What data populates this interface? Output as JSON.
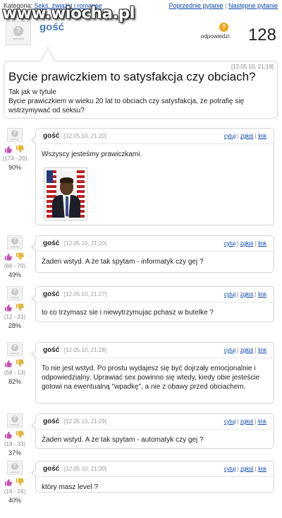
{
  "watermark": "www.wiocha.pl",
  "category": {
    "label": "Kategoria:",
    "value": "Seks, związki i romanse"
  },
  "nav": {
    "prev": "Poprzednie pytanie",
    "sep": "|",
    "next": "Następne pytanie"
  },
  "op": {
    "name": "gość",
    "avatar_text": "samotuto"
  },
  "answers": {
    "label": "odpowiedzi:",
    "count": "128"
  },
  "question": {
    "date": "[12.05.10, 21:19]",
    "title": "Bycie prawiczkiem to satysfakcja czy obciach?",
    "body": "Tak jak w tytule\nBycie prawiczkiem w wieku 20 lat to obciach czy satysfakcja, że potrafię się wstrzymywać od seksu?"
  },
  "link_labels": {
    "quote": "cytuj",
    "report": "zgłoś",
    "link": "link",
    "sep": "|"
  },
  "comments": [
    {
      "author": "gość",
      "date": "[12.05.10, 21:20]",
      "text": "Wszyscy jesteśmy prawiczkami.",
      "votes": "(174 - 20)",
      "percent": "90%",
      "has_image": true
    },
    {
      "author": "gość",
      "date": "[12.05.10, 21:20]",
      "text": "Żaden wstyd. A że tak spytam - informatyk czy gej ?",
      "votes": "(66 - 70)",
      "percent": "49%",
      "has_image": false
    },
    {
      "author": "gość",
      "date": "[12.05.10, 21:27]",
      "text": "to co trzymasz sie i niewytrzymujac pchasz w butelke ?",
      "votes": "(12 - 31)",
      "percent": "28%",
      "has_image": false
    },
    {
      "author": "gość",
      "date": "[12.05.10, 21:28]",
      "text": "To nie jest wstyd. Po prostu wydajesz się być dojrzały emocjonalnie i odpowiedzialny. Uprawiać sex powinno się wtedy, kiedy obie jesteście gotowi na ewentualną \"wpadkę\", a nie z obawy przed obciachem.",
      "votes": "(58 - 13)",
      "percent": "82%",
      "has_image": false
    },
    {
      "author": "gość",
      "date": "[12.05.10, 21:29]",
      "text": "Żaden wstyd. A że tak spytam - automatyk czy gej ?",
      "votes": "(19 - 33)",
      "percent": "37%",
      "has_image": false
    },
    {
      "author": "gość",
      "date": "[12.05.10, 21:30]",
      "text": "który masz level ?",
      "votes": "(16 - 24)",
      "percent": "40%",
      "has_image": false
    }
  ],
  "colors": {
    "link": "#0645ad",
    "op_name": "#4a7bbf",
    "thumb_up": "#c34fb5",
    "thumb_down": "#e3b63a",
    "answers_icon": "#f1a51c"
  }
}
